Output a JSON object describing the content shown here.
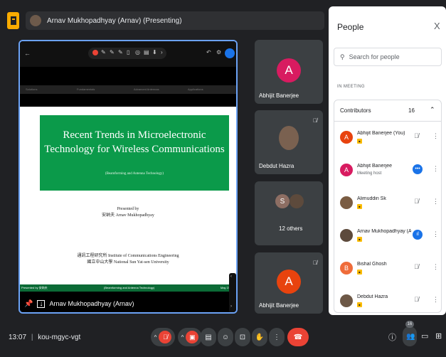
{
  "topbar": {
    "presenter_label": "Arnav Mukhopadhyay (Arnav) (Presenting)"
  },
  "stage": {
    "slide_nav": [
      "Solutions",
      "Fundamentals",
      "Advanced Antennas",
      "Applications"
    ],
    "slide_title": "Recent Trends in Microelectronic Technology for Wireless Communications",
    "slide_subtitle": "(Beamforming and Antenna Technology)",
    "presented_by": "Presented by",
    "presenter_line": "安纳夫  Arnav Mukhopadhyay",
    "institute_1": "通訊工程研究所  Institute of Communications Engineering",
    "institute_2": "國立中山大學  National Sun Yat-sen University",
    "footer_left": "Presented by 安纳夫",
    "footer_mid": "(Beamforming and Antenna Technology)",
    "footer_right": "May 21",
    "presenter_name": "Arnav Mukhopadhyay (Arnav)"
  },
  "tiles": [
    {
      "name": "Abhijit Banerjee",
      "initial": "A",
      "color": "#d81b60"
    },
    {
      "name": "Debdut Hazra"
    },
    {
      "name": "12 others",
      "initial": "S",
      "color": "#8d6e63"
    },
    {
      "name": "Abhijit Banerjee",
      "initial": "A",
      "color": "#e8430e"
    }
  ],
  "panel": {
    "title": "People",
    "close": "X",
    "search_placeholder": "Search for people",
    "section": "IN MEETING",
    "group": "Contributors",
    "count": "16",
    "people": [
      {
        "name": "Abhijit Banerjee (You)",
        "sub": "",
        "initial": "A",
        "color": "#e8430e"
      },
      {
        "name": "Abhijit Banerjee",
        "sub": "Meeting host",
        "initial": "A",
        "color": "#d81b60"
      },
      {
        "name": "Alimuddin Sk",
        "sub": "",
        "initial": "",
        "color": "#7a5c43"
      },
      {
        "name": "Arnav Mukhopadhyay (A...",
        "sub": "",
        "initial": "",
        "color": "#5d4a3c"
      },
      {
        "name": "Bishal Ghosh",
        "sub": "",
        "initial": "B",
        "color": "#ef6c3a"
      },
      {
        "name": "Debdut Hazra",
        "sub": "",
        "initial": "",
        "color": "#6d5846"
      }
    ]
  },
  "bottombar": {
    "time": "13:07",
    "separator": "|",
    "meeting_code": "kou-mgyc-vgt",
    "participant_badge": "16"
  }
}
